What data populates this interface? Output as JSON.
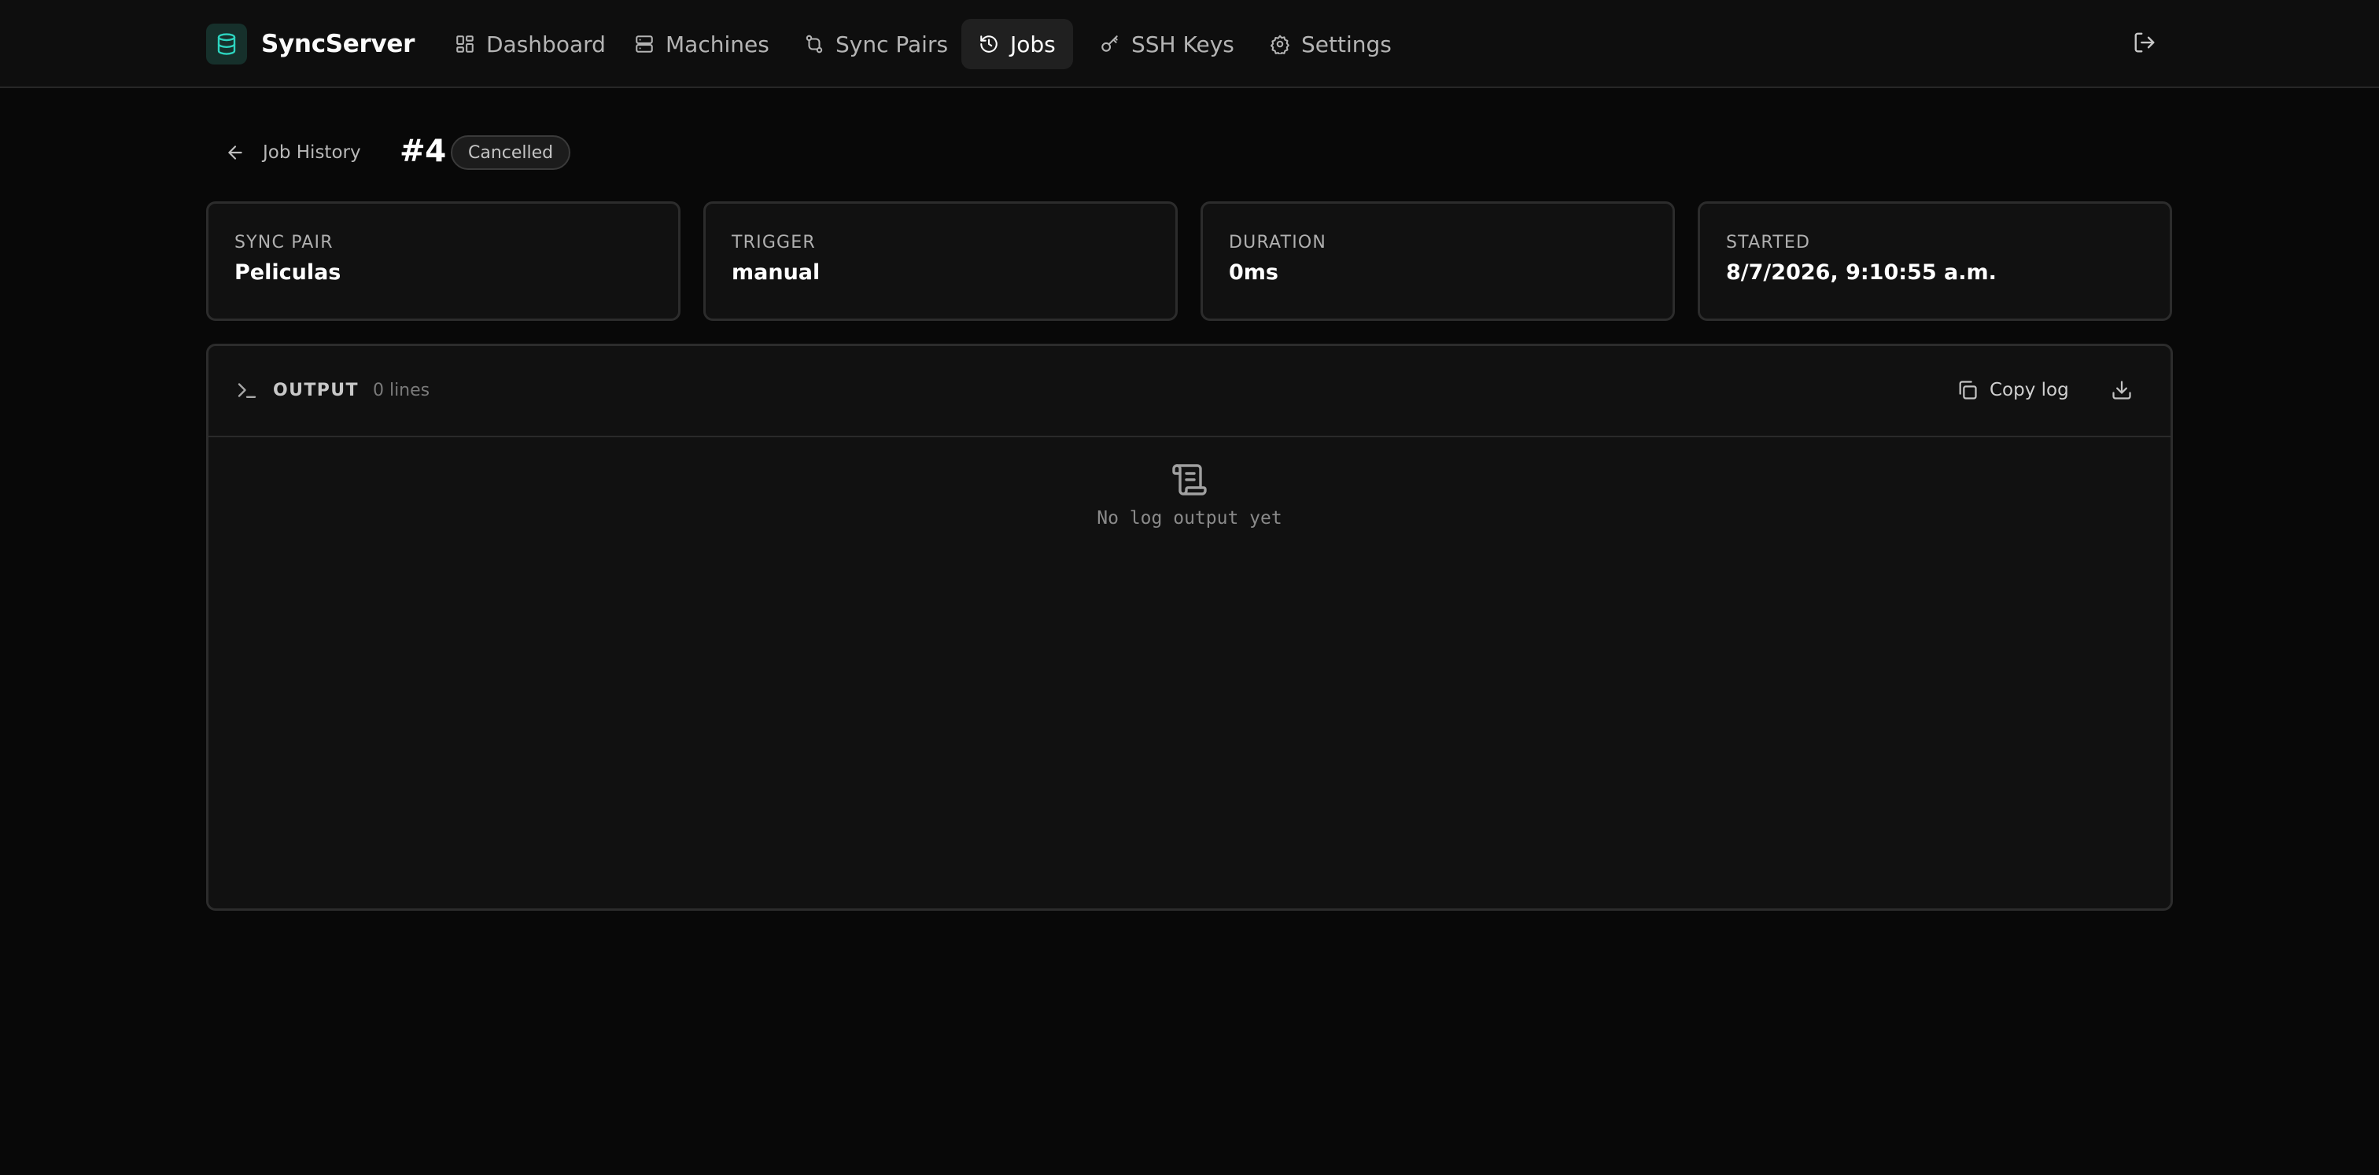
{
  "app": {
    "name": "SyncServer",
    "logo_icon": "database-icon",
    "accent_color": "#2dd4bf"
  },
  "nav": {
    "items": [
      {
        "label": "Dashboard",
        "icon": "dashboard-icon",
        "active": false
      },
      {
        "label": "Machines",
        "icon": "server-icon",
        "active": false
      },
      {
        "label": "Sync Pairs",
        "icon": "git-compare-icon",
        "active": false
      },
      {
        "label": "Jobs",
        "icon": "history-icon",
        "active": true
      },
      {
        "label": "SSH Keys",
        "icon": "key-icon",
        "active": false
      },
      {
        "label": "Settings",
        "icon": "gear-icon",
        "active": false
      }
    ],
    "logout_icon": "logout-icon"
  },
  "header": {
    "back_label": "Job History",
    "job_number": "#4",
    "status": "Cancelled"
  },
  "stats": [
    {
      "label": "Sync Pair",
      "value": "Peliculas"
    },
    {
      "label": "Trigger",
      "value": "manual"
    },
    {
      "label": "Duration",
      "value": "0ms"
    },
    {
      "label": "Started",
      "value": "8/7/2026, 9:10:55 a.m."
    }
  ],
  "output": {
    "title": "OUTPUT",
    "line_count": "0 lines",
    "copy_label": "Copy log",
    "download_icon": "download-icon",
    "empty_message": "No log output yet",
    "empty_icon": "scroll-icon"
  }
}
